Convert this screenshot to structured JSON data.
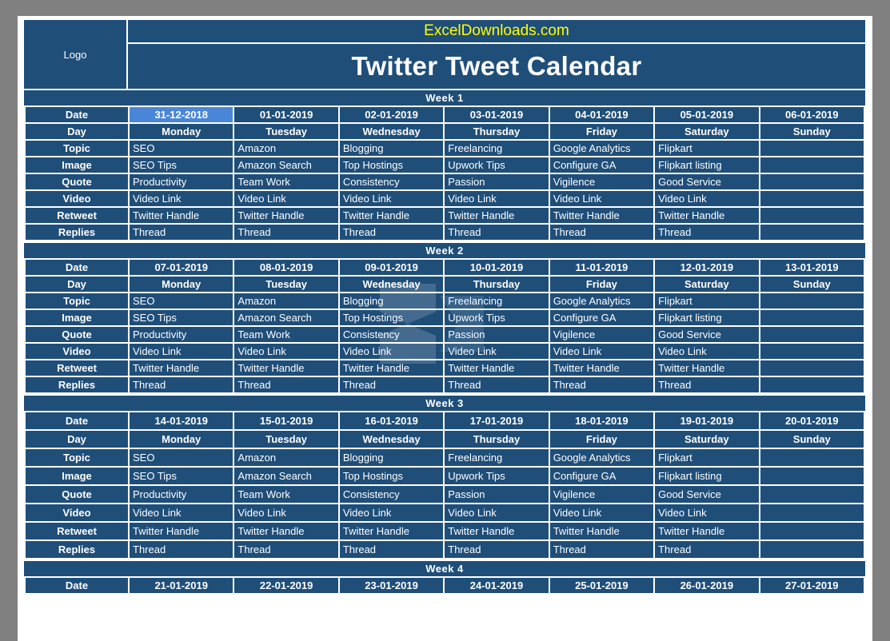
{
  "header": {
    "logo_label": "Logo",
    "site": "ExcelDownloads.com",
    "title": "Twitter Tweet Calendar",
    "brand_color": "#1f4e79",
    "accent_color": "#4a86d8",
    "site_color": "#ffff00"
  },
  "row_labels": [
    "Date",
    "Day",
    "Topic",
    "Image",
    "Quote",
    "Video",
    "Retweet",
    "Replies"
  ],
  "days": [
    "Monday",
    "Tuesday",
    "Wednesday",
    "Thursday",
    "Friday",
    "Saturday",
    "Sunday"
  ],
  "topics": [
    "SEO",
    "Amazon",
    "Blogging",
    "Freelancing",
    "Google Analytics",
    "Flipkart",
    ""
  ],
  "images": [
    "SEO Tips",
    "Amazon Search",
    "Top Hostings",
    "Upwork Tips",
    "Configure GA",
    "Flipkart listing",
    ""
  ],
  "quotes": [
    "Productivity",
    "Team Work",
    "Consistency",
    "Passion",
    "Vigilence",
    "Good Service",
    ""
  ],
  "videos": [
    "Video Link",
    "Video Link",
    "Video Link",
    "Video Link",
    "Video Link",
    "Video Link",
    ""
  ],
  "retweets": [
    "Twitter Handle",
    "Twitter Handle",
    "Twitter Handle",
    "Twitter Handle",
    "Twitter Handle",
    "Twitter Handle",
    ""
  ],
  "replies": [
    "Thread",
    "Thread",
    "Thread",
    "Thread",
    "Thread",
    "Thread",
    ""
  ],
  "weeks": [
    {
      "label": "Week  1",
      "dates": [
        "31-12-2018",
        "01-01-2019",
        "02-01-2019",
        "03-01-2019",
        "04-01-2019",
        "05-01-2019",
        "06-01-2019"
      ],
      "highlight_index": 0
    },
    {
      "label": "Week  2",
      "dates": [
        "07-01-2019",
        "08-01-2019",
        "09-01-2019",
        "10-01-2019",
        "11-01-2019",
        "12-01-2019",
        "13-01-2019"
      ],
      "highlight_index": -1
    },
    {
      "label": "Week  3",
      "dates": [
        "14-01-2019",
        "15-01-2019",
        "16-01-2019",
        "17-01-2019",
        "18-01-2019",
        "19-01-2019",
        "20-01-2019"
      ],
      "highlight_index": -1
    },
    {
      "label": "Week  4",
      "dates": [
        "21-01-2019",
        "22-01-2019",
        "23-01-2019",
        "24-01-2019",
        "25-01-2019",
        "26-01-2019",
        "27-01-2019"
      ],
      "highlight_index": -1,
      "partial": true
    }
  ]
}
